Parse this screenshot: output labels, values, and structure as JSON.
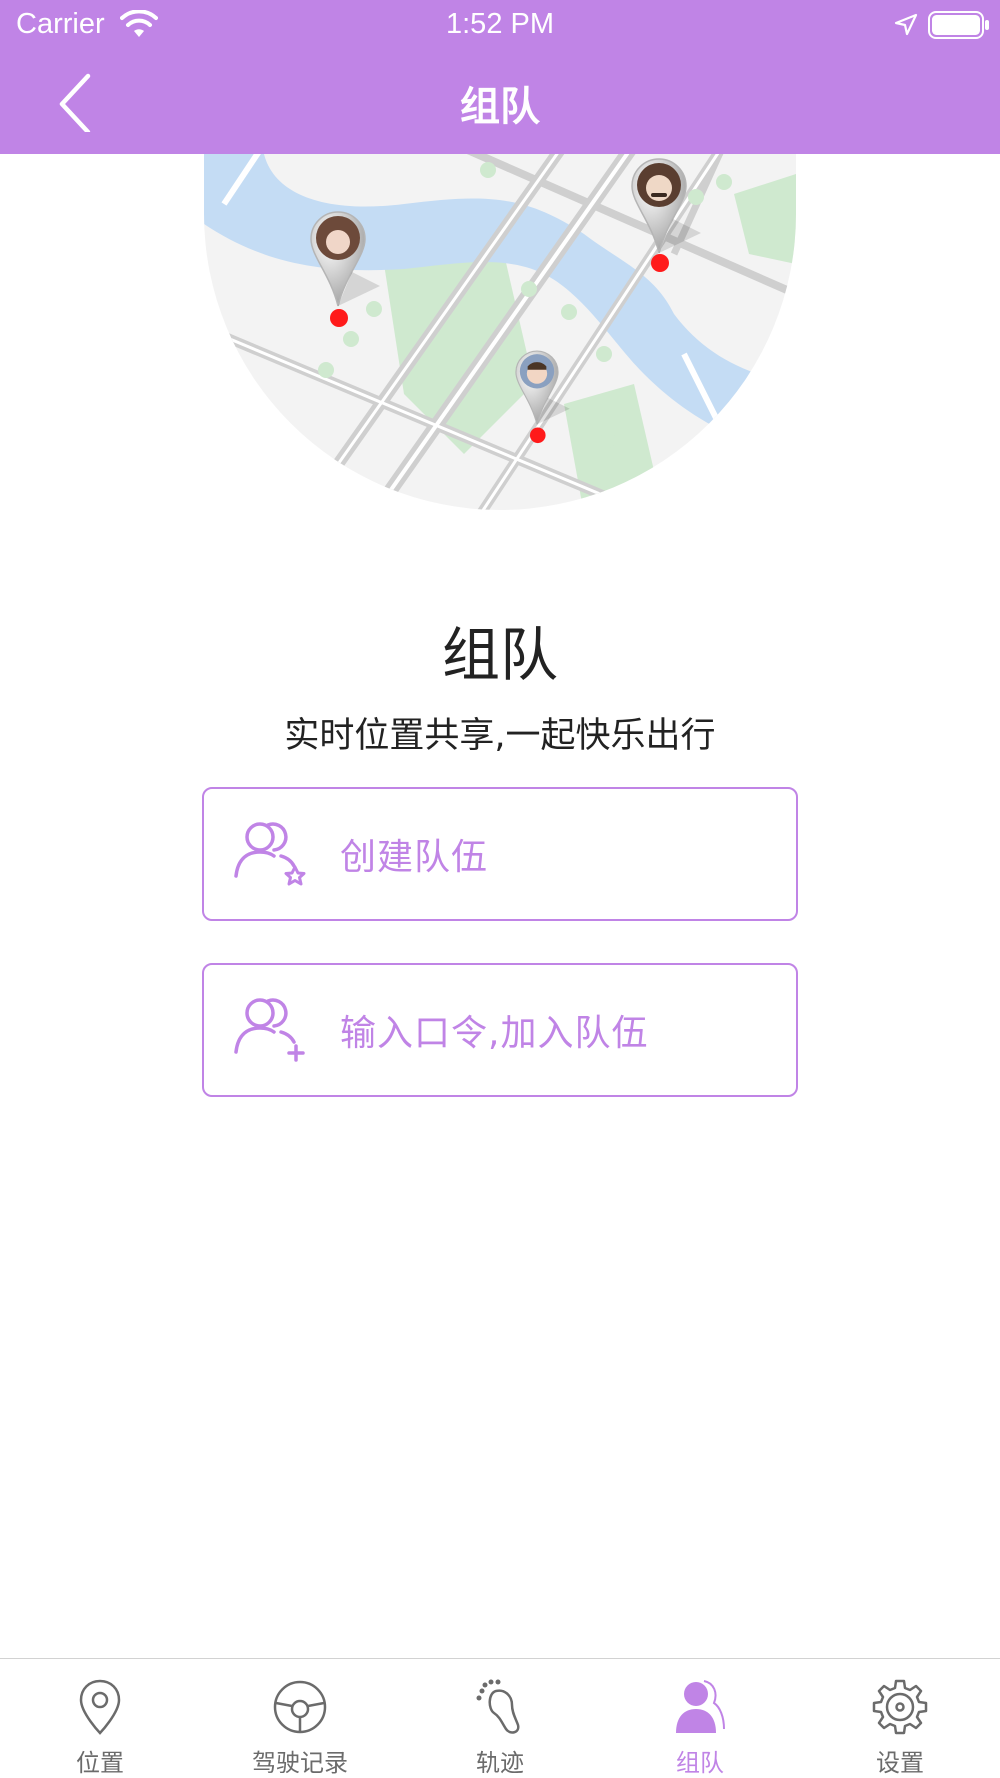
{
  "status_bar": {
    "carrier": "Carrier",
    "time": "1:52 PM"
  },
  "nav": {
    "title": "组队",
    "back_icon": "chevron-left-icon"
  },
  "main": {
    "heading": "组队",
    "subheading": "实时位置共享,一起快乐出行",
    "buttons": [
      {
        "label": "创建队伍",
        "icon": "team-star-icon"
      },
      {
        "label": "输入口令,加入队伍",
        "icon": "team-add-icon"
      }
    ]
  },
  "tab_bar": {
    "items": [
      {
        "label": "位置",
        "icon": "location-pin-icon",
        "active": false
      },
      {
        "label": "驾驶记录",
        "icon": "steering-wheel-icon",
        "active": false
      },
      {
        "label": "轨迹",
        "icon": "footprint-icon",
        "active": false
      },
      {
        "label": "组队",
        "icon": "team-icon",
        "active": true
      },
      {
        "label": "设置",
        "icon": "gear-icon",
        "active": false
      }
    ]
  },
  "colors": {
    "accent": "#c084e6",
    "text": "#222222",
    "tab_inactive": "#6b6b6b",
    "map_water": "#c4dcf4",
    "map_park": "#cfe9cf",
    "map_road": "#d4d4d4",
    "pin_dot": "#ff1a1a"
  }
}
